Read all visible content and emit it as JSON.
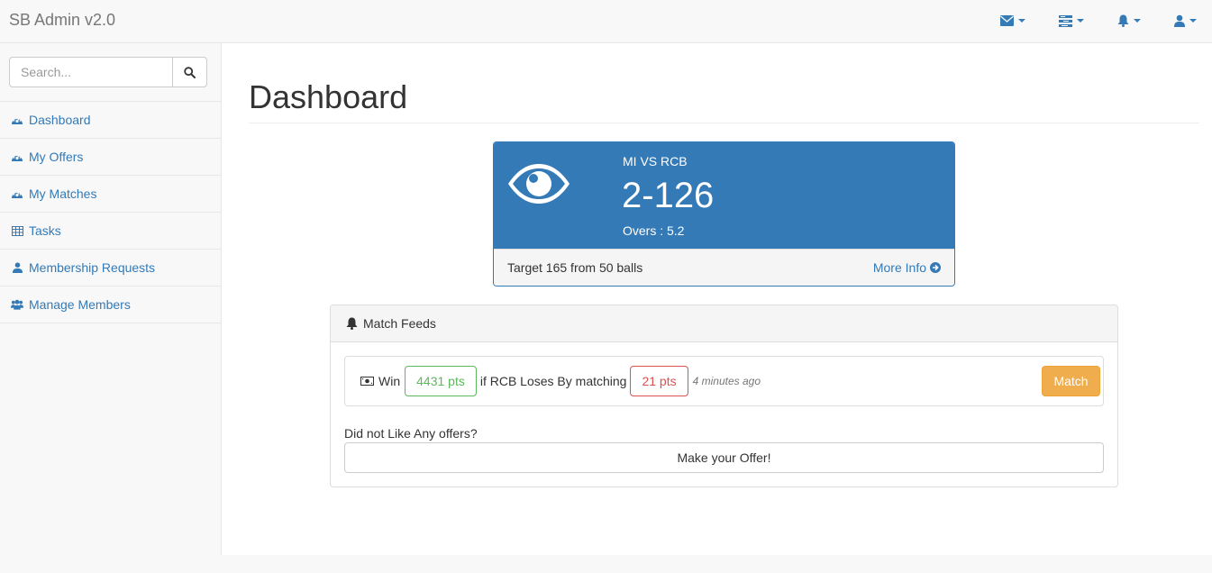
{
  "brand": "SB Admin v2.0",
  "navbar": {
    "icons": [
      "envelope-icon",
      "tasks-icon",
      "bell-icon",
      "user-icon"
    ]
  },
  "sidebar": {
    "search_placeholder": "Search...",
    "items": [
      {
        "label": "Dashboard",
        "icon": "dashboard-icon"
      },
      {
        "label": "My Offers",
        "icon": "dashboard-icon"
      },
      {
        "label": "My Matches",
        "icon": "dashboard-icon"
      },
      {
        "label": "Tasks",
        "icon": "table-icon"
      },
      {
        "label": "Membership Requests",
        "icon": "user-icon"
      },
      {
        "label": "Manage Members",
        "icon": "users-icon"
      }
    ]
  },
  "page": {
    "title": "Dashboard"
  },
  "score_panel": {
    "match": "MI VS RCB",
    "score": "2-126",
    "overs": "Overs : 5.2",
    "target": "Target 165 from 50 balls",
    "more_info": "More Info",
    "color": "#337ab7"
  },
  "feeds": {
    "title": "Match Feeds",
    "offer": {
      "win_label": "Win",
      "win_pts": "4431 pts",
      "condition": "if RCB Loses By matching",
      "lose_pts": "21 pts",
      "time": "4 minutes ago",
      "button": "Match"
    },
    "no_like": "Did not Like Any offers?",
    "make_offer": "Make your Offer!"
  },
  "colors": {
    "primary": "#337ab7",
    "success": "#5cb85c",
    "danger": "#d9534f",
    "warning": "#f0ad4e"
  }
}
